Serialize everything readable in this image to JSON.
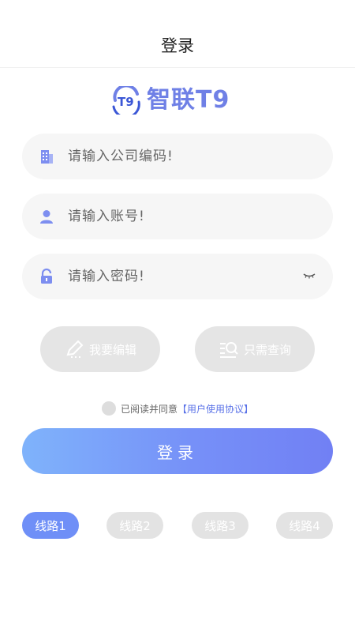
{
  "header": {
    "title": "登录"
  },
  "logo": {
    "text": "智联T9"
  },
  "form": {
    "company": {
      "placeholder": "请输入公司编码!",
      "value": ""
    },
    "account": {
      "placeholder": "请输入账号!",
      "value": ""
    },
    "password": {
      "placeholder": "请输入密码!",
      "value": ""
    }
  },
  "actions": {
    "edit_label": "我要编辑",
    "query_label": "只需查询"
  },
  "agreement": {
    "prefix": "已阅读并同意",
    "link": "【用户使用协议】"
  },
  "login_label": "登录",
  "lines": [
    {
      "label": "线路1",
      "active": true
    },
    {
      "label": "线路2",
      "active": false
    },
    {
      "label": "线路3",
      "active": false
    },
    {
      "label": "线路4",
      "active": false
    }
  ],
  "colors": {
    "brand": "#6f80e6",
    "accent": "#7690f8",
    "link": "#5b73e8",
    "inactive": "#e3e3e3"
  },
  "icons": [
    "building-icon",
    "user-icon",
    "lock-icon",
    "eye-closed-icon",
    "pencil-icon",
    "search-list-icon"
  ]
}
